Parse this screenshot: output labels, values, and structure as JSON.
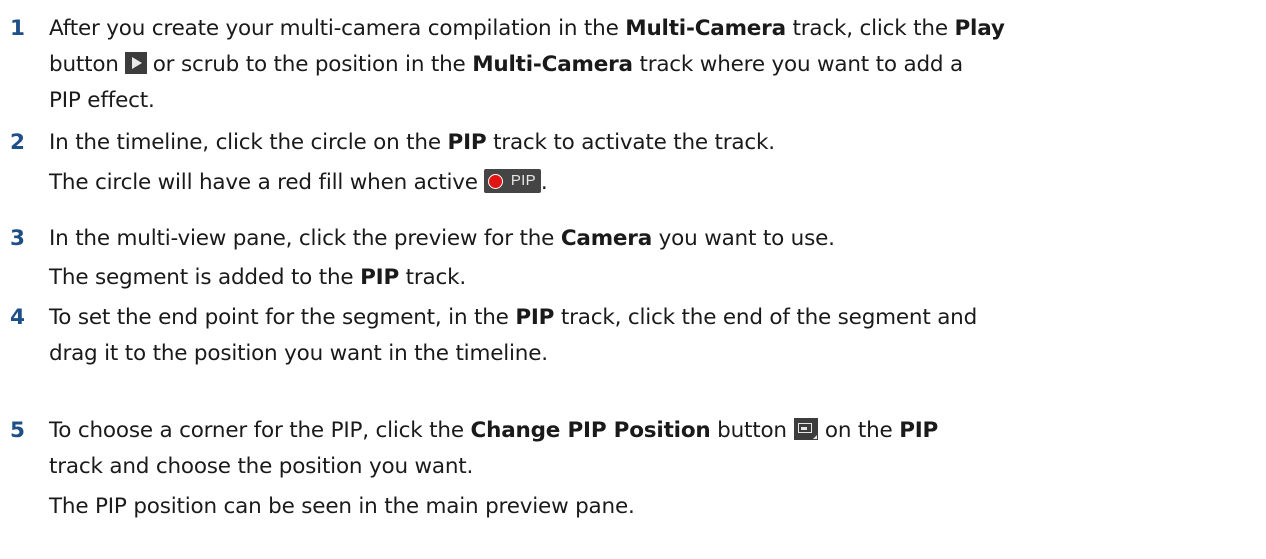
{
  "steps": [
    {
      "number": "1",
      "lines": [
        {
          "a": "After you create your multi-camera compilation in the ",
          "b1": "Multi-Camera",
          "c": " track, click the ",
          "b2": "Play"
        },
        {
          "a": "button",
          "icon": "play-icon",
          "c": "or scrub to the position in the ",
          "b1": "Multi-Camera",
          "d": " track where you want to add a"
        },
        {
          "a": "PIP effect."
        }
      ]
    },
    {
      "number": "2",
      "lines": [
        {
          "a": "In the timeline, click the circle on the ",
          "b1": "PIP",
          "c": " track to activate the track."
        },
        {
          "a": "The circle will have a red fill when active",
          "badge": "PIP",
          "end": "."
        }
      ]
    },
    {
      "number": "3",
      "lines": [
        {
          "a": "In the multi-view pane, click the preview for the ",
          "b1": "Camera",
          "c": " you want to use."
        },
        {
          "a": "The segment is added to the ",
          "b1": "PIP",
          "c": " track."
        }
      ]
    },
    {
      "number": "4",
      "lines": [
        {
          "a": "To set the end point for the segment, in the ",
          "b1": "PIP",
          "c": " track, click the end of the segment and"
        },
        {
          "a": "drag it to the position you want in the timeline."
        }
      ]
    },
    {
      "number": "5",
      "lines": [
        {
          "a": "To choose a corner for the PIP, click the ",
          "b1": "Change PIP Position",
          "c": " button",
          "icon": "picture-in-picture-icon",
          "d": "on the ",
          "b2": "PIP"
        },
        {
          "a": "track and choose the position you want."
        },
        {
          "a": "The PIP position can be seen in the main preview pane."
        }
      ]
    }
  ],
  "colors": {
    "step_number": "#1e4f86",
    "text": "#1a1a1a",
    "pip_dot": "#e21414",
    "icon_bg": "#3c3c3c"
  }
}
